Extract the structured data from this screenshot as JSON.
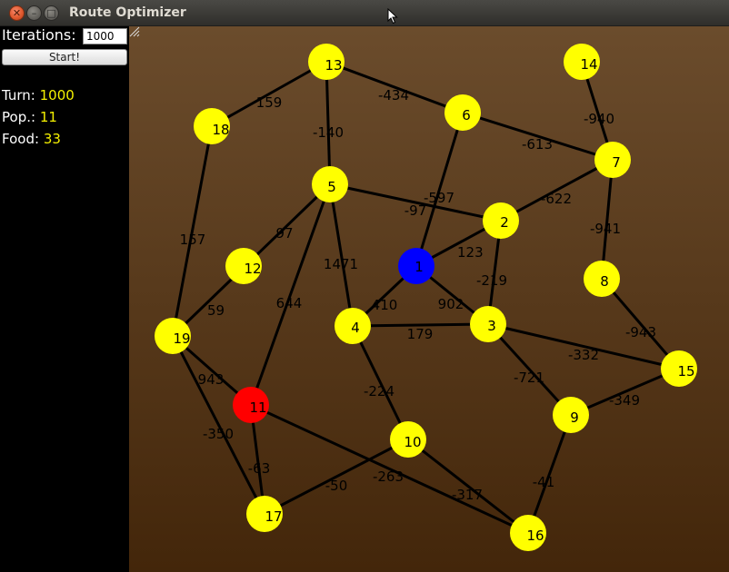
{
  "window": {
    "title": "Route Optimizer"
  },
  "controls": {
    "iterations_label": "Iterations:",
    "iterations_value": "1000",
    "start_label": "Start!"
  },
  "stats": [
    {
      "label": "Turn:",
      "value": "1000"
    },
    {
      "label": "Pop.:",
      "value": "11"
    },
    {
      "label": "Food:",
      "value": "33"
    }
  ],
  "colors": {
    "node": "#ffff00",
    "highlight_blue": "#0000ff",
    "highlight_red": "#ff0000",
    "edge": "#000000",
    "stat_value": "#f4f000"
  },
  "graph": {
    "nodes": [
      {
        "id": "1",
        "color": "blue"
      },
      {
        "id": "2",
        "color": "yellow"
      },
      {
        "id": "3",
        "color": "yellow"
      },
      {
        "id": "4",
        "color": "yellow"
      },
      {
        "id": "5",
        "color": "yellow"
      },
      {
        "id": "6",
        "color": "yellow"
      },
      {
        "id": "7",
        "color": "yellow"
      },
      {
        "id": "8",
        "color": "yellow"
      },
      {
        "id": "9",
        "color": "yellow"
      },
      {
        "id": "10",
        "color": "yellow"
      },
      {
        "id": "11",
        "color": "red"
      },
      {
        "id": "12",
        "color": "yellow"
      },
      {
        "id": "13",
        "color": "yellow"
      },
      {
        "id": "14",
        "color": "yellow"
      },
      {
        "id": "15",
        "color": "yellow"
      },
      {
        "id": "16",
        "color": "yellow"
      },
      {
        "id": "17",
        "color": "yellow"
      },
      {
        "id": "18",
        "color": "yellow"
      },
      {
        "id": "19",
        "color": "yellow"
      }
    ],
    "edges": [
      {
        "from": "13",
        "to": "18",
        "weight": "159"
      },
      {
        "from": "13",
        "to": "6",
        "weight": "-434"
      },
      {
        "from": "13",
        "to": "5",
        "weight": "-140"
      },
      {
        "from": "6",
        "to": "7",
        "weight": "-613"
      },
      {
        "from": "6",
        "to": "1",
        "weight": "-97"
      },
      {
        "from": "14",
        "to": "7",
        "weight": "-940"
      },
      {
        "from": "7",
        "to": "1",
        "weight": "-622"
      },
      {
        "from": "7",
        "to": "8",
        "weight": "-941"
      },
      {
        "from": "5",
        "to": "2",
        "weight": "-597"
      },
      {
        "from": "5",
        "to": "19",
        "weight": "97"
      },
      {
        "from": "5",
        "to": "4",
        "weight": "1471"
      },
      {
        "from": "5",
        "to": "11",
        "weight": "644"
      },
      {
        "from": "18",
        "to": "19",
        "weight": "157"
      },
      {
        "from": "1",
        "to": "4",
        "weight": "410"
      },
      {
        "from": "1",
        "to": "3",
        "weight": "902"
      },
      {
        "from": "2",
        "to": "3",
        "weight": "-219"
      },
      {
        "from": "4",
        "to": "3",
        "weight": "179"
      },
      {
        "from": "4",
        "to": "10",
        "weight": "-224"
      },
      {
        "from": "3",
        "to": "15",
        "weight": "-332"
      },
      {
        "from": "3",
        "to": "9",
        "weight": "-721"
      },
      {
        "from": "8",
        "to": "15",
        "weight": "-943"
      },
      {
        "from": "15",
        "to": "9",
        "weight": "-349"
      },
      {
        "from": "9",
        "to": "16",
        "weight": "-41"
      },
      {
        "from": "19",
        "to": "11",
        "weight": "943"
      },
      {
        "from": "19",
        "to": "17",
        "weight": "-350"
      },
      {
        "from": "11",
        "to": "17",
        "weight": "-63"
      },
      {
        "from": "11",
        "to": "16",
        "weight": "-263"
      },
      {
        "from": "10",
        "to": "16",
        "weight": "-317"
      },
      {
        "from": "10",
        "to": "17",
        "weight": "-50"
      }
    ],
    "extra_labels": [
      "123",
      "59"
    ]
  }
}
